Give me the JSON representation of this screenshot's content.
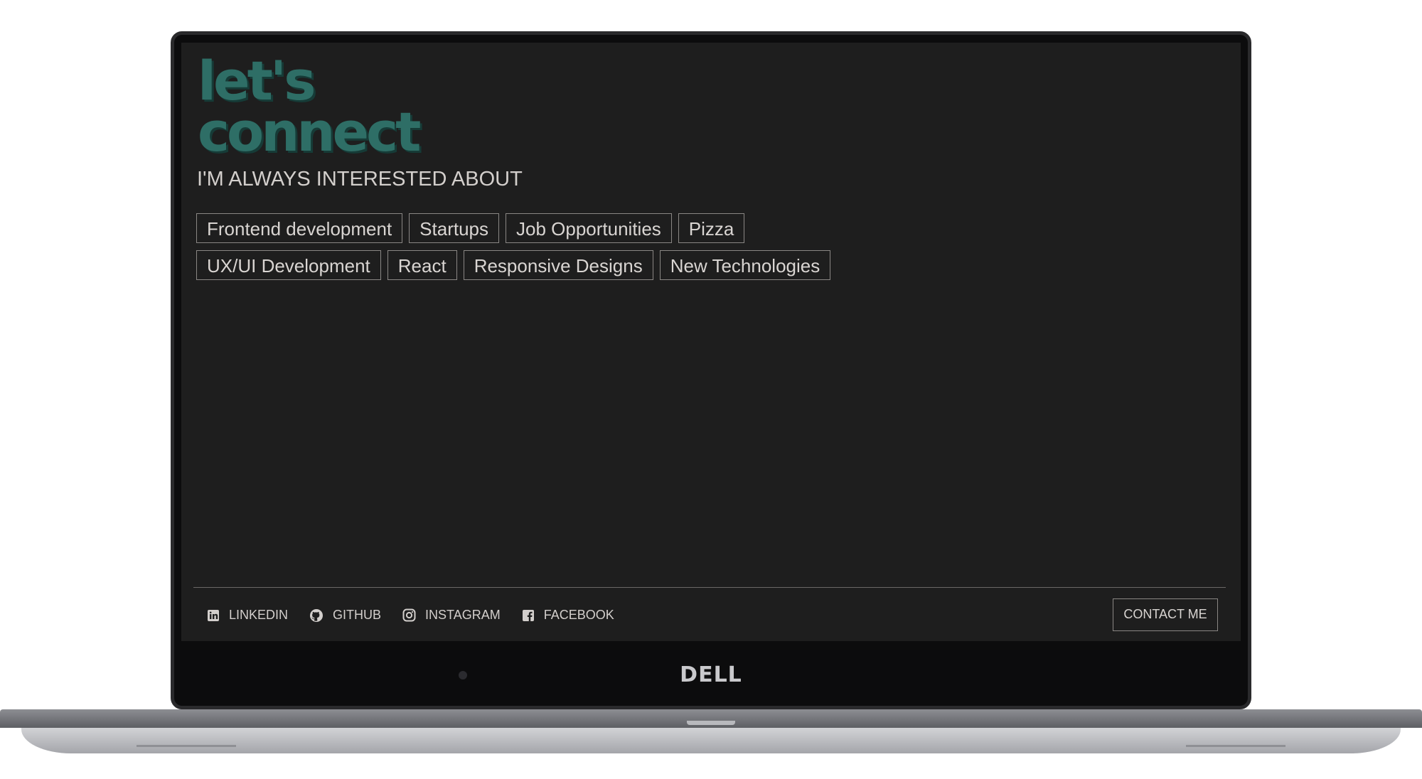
{
  "device": {
    "brand": "DELL"
  },
  "logo": {
    "line1": "let's",
    "line2": "connect"
  },
  "heading": "I'M ALWAYS INTERESTED ABOUT",
  "tags": [
    [
      "Frontend development",
      "Startups",
      "Job Opportunities",
      "Pizza"
    ],
    [
      "UX/UI Development",
      "React",
      "Responsive Designs",
      "New Technologies"
    ]
  ],
  "social": [
    {
      "label": "LINKEDIN",
      "icon": "linkedin-icon"
    },
    {
      "label": "GITHUB",
      "icon": "github-icon"
    },
    {
      "label": "INSTAGRAM",
      "icon": "instagram-icon"
    },
    {
      "label": "FACEBOOK",
      "icon": "facebook-icon"
    }
  ],
  "contact_button": "CONTACT ME",
  "colors": {
    "background": "#1e1e1e",
    "accent": "#2e6e66",
    "text": "#d3cfcc",
    "border": "#8a8784"
  }
}
